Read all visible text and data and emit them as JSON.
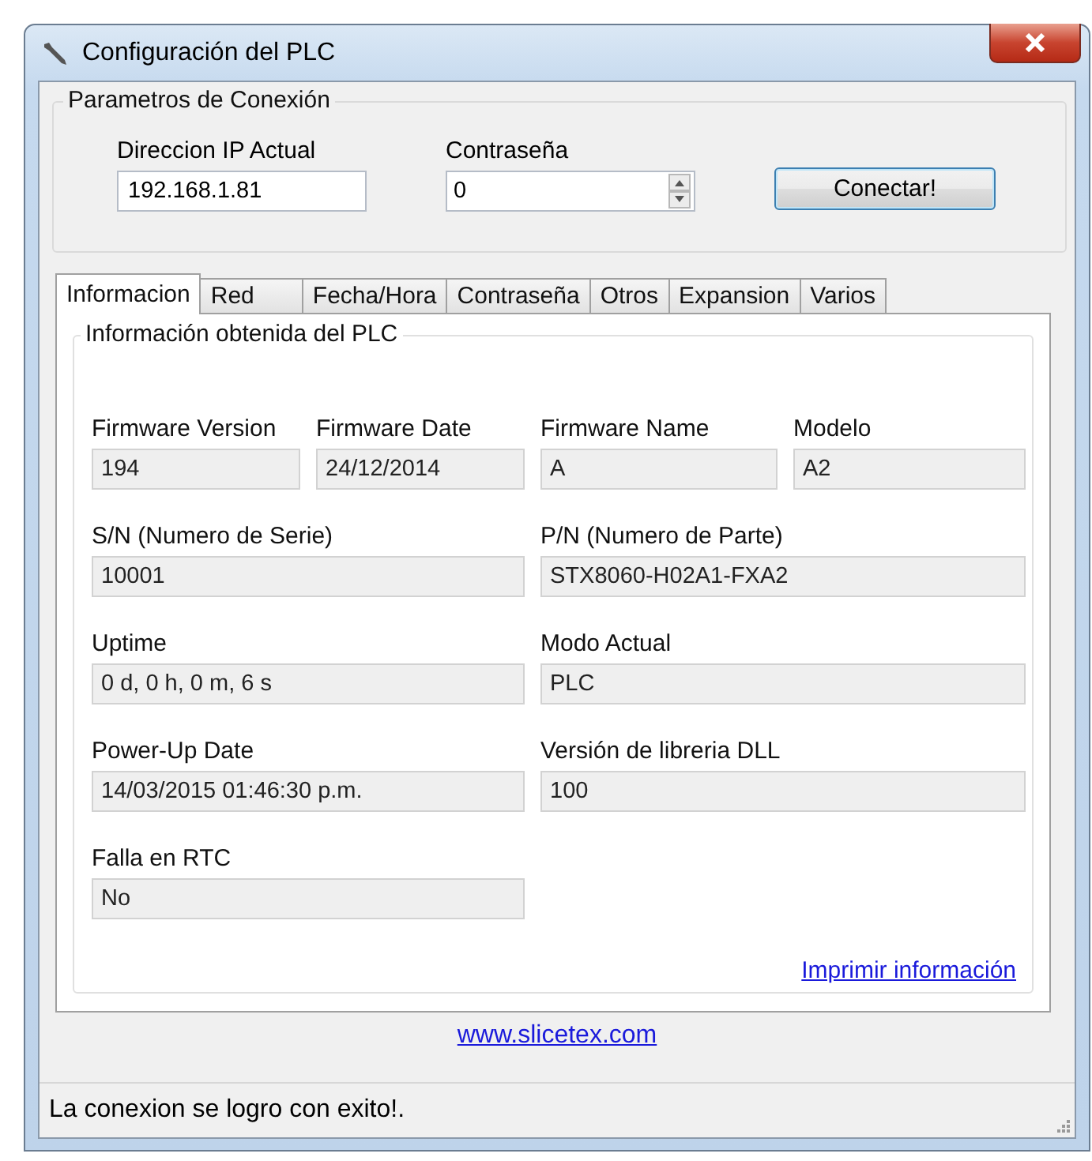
{
  "window": {
    "title": "Configuración del PLC"
  },
  "connection": {
    "title": "Parametros de Conexión",
    "ip": {
      "label": "Direccion IP Actual",
      "value": "192.168.1.81"
    },
    "password": {
      "label": "Contraseña",
      "value": "0"
    },
    "connect_button": "Conectar!"
  },
  "tabs": [
    {
      "label": "Informacion",
      "selected": true
    },
    {
      "label": "Red",
      "selected": false
    },
    {
      "label": "Fecha/Hora",
      "selected": false
    },
    {
      "label": "Contraseña",
      "selected": false
    },
    {
      "label": "Otros",
      "selected": false
    },
    {
      "label": "Expansion",
      "selected": false
    },
    {
      "label": "Varios",
      "selected": false
    }
  ],
  "info_group": {
    "title": "Información obtenida del PLC",
    "rows": [
      [
        {
          "label": "Firmware Version",
          "value": "194"
        },
        {
          "label": "Firmware Date",
          "value": "24/12/2014"
        },
        {
          "label": "Firmware Name",
          "value": "A"
        },
        {
          "label": "Modelo",
          "value": "A2"
        }
      ],
      [
        {
          "label": "S/N (Numero de Serie)",
          "value": "10001"
        },
        {
          "label": "P/N (Numero de Parte)",
          "value": "STX8060-H02A1-FXA2"
        }
      ],
      [
        {
          "label": "Uptime",
          "value": "0 d, 0 h, 0 m, 6 s"
        },
        {
          "label": "Modo Actual",
          "value": "PLC"
        }
      ],
      [
        {
          "label": "Power-Up Date",
          "value": "14/03/2015 01:46:30 p.m."
        },
        {
          "label": "Versión de libreria DLL",
          "value": "100"
        }
      ],
      [
        {
          "label": "Falla en RTC",
          "value": "No"
        }
      ]
    ],
    "print_link": "Imprimir información"
  },
  "website_link": "www.slicetex.com",
  "status_bar": "La conexion se logro con exito!."
}
